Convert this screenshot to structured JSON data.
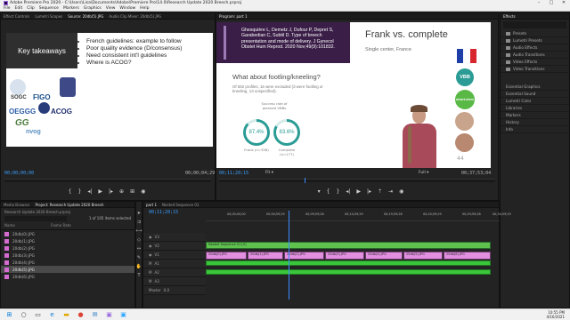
{
  "window": {
    "title": "Adobe Premiere Pro 2020 - C:\\Users\\Lisa\\Documents\\Adobe\\Premiere Pro\\14.0\\Research Update 2020 Breech.prproj",
    "controls": [
      "–",
      "□",
      "✕"
    ]
  },
  "menu": [
    "File",
    "Edit",
    "Clip",
    "Sequence",
    "Markers",
    "Graphics",
    "View",
    "Window",
    "Help"
  ],
  "source_panel": {
    "tabs": [
      "Effect Controls",
      "Lumetri Scopes",
      "Source: 20db(5).JPG",
      "Audio Clip Mixer: 20db(5).JPG"
    ],
    "timecode_in": "00;00;00;00",
    "timecode_out": "00;00;04;29",
    "slide": {
      "heading": "Key takeaways",
      "bullets": [
        "French guidelines: example to follow",
        "Poor quality evidence (D/consensus)",
        "Need consistent int'l guidelines",
        "Where is ACOG?"
      ],
      "logos": [
        "SOGC",
        "FIGO",
        "OEGGG",
        "ACOG",
        "GG",
        "nvog"
      ]
    }
  },
  "program_panel": {
    "tab": "Program: part 1",
    "timecode": "00;11;20;15",
    "fit": "Fit",
    "quality": "Full",
    "duration": "00;37;53;04",
    "slide": {
      "citation": "Ghesquière L, Demetz J, Dufour P, Depret S, Garabedian C, Subtil D. Type of breech presentation and mode of delivery. J Gynecol Obstet Hum Reprod. 2020 Nov;49(9):101832.",
      "title": "Frank vs. complete",
      "subtitle": "Single center, France",
      "question": "What about footling/kneeling?",
      "question_sub": "Of 592 profiles, 16 were excluded (3 were footling or kneeling, 13 unspecified).",
      "donut_caption": "Success rate of planned VBBs",
      "donuts": [
        {
          "value": "87.4%",
          "label": "Frank (n=358)",
          "fraction": 0.874
        },
        {
          "value": "83.6%",
          "label": "Complete (n=177)",
          "fraction": 0.836
        }
      ],
      "badges": [
        "VBB",
        "short-term"
      ],
      "page_number": "44"
    }
  },
  "effects_panel": {
    "title": "Effects",
    "items": [
      "Presets",
      "Lumetri Presets",
      "Audio Effects",
      "Audio Transitions",
      "Video Effects",
      "Video Transitions"
    ],
    "sections": [
      "Essential Graphics",
      "Essential Sound",
      "Lumetri Color",
      "Libraries",
      "Markers",
      "History",
      "Info"
    ]
  },
  "project_panel": {
    "tabs": [
      "Media Browser",
      "Project: Research Update 2020 Breech"
    ],
    "project_file": "Research Update 2020 Breech.prproj",
    "selection": "1 of 105 items selected",
    "columns": [
      "Name",
      "Frame Rate"
    ],
    "items": [
      "20db(0).JPG",
      "20db(1).JPG",
      "20db(2).JPG",
      "20db(3).JPG",
      "20db(4).JPG",
      "20db(5).JPG",
      "20db(6).JPG"
    ],
    "selected_index": 5
  },
  "timeline": {
    "tabs": [
      "part 1",
      "Nested Sequence 01"
    ],
    "timecode": "00;11;20;15",
    "ruler": [
      "00;00;00;00",
      "00;04;59;29",
      "00;09;59;28",
      "00;14;59;29",
      "00;19;59;28",
      "00;24;59;29",
      "00;29;59;28",
      "00;34;59;29"
    ],
    "tracks": [
      "V3",
      "V2",
      "V1",
      "A1",
      "A2",
      "A3"
    ],
    "master": "Master",
    "master_value": "0.0",
    "v3_clip": "Nested Sequence 01 [V]",
    "v1_clips": [
      "20db(0).JPG",
      "20db(1).JPG",
      "20db(2).JPG",
      "20db(3).JPG",
      "20db(4).JPG",
      "20db(5).JPG",
      "20db(6).JPG"
    ]
  },
  "taskbar": {
    "time": "10:55 PM",
    "date": "4/16/2021"
  },
  "colors": {
    "accent": "#3b9fff",
    "citation_bg": "#3a1e47",
    "teal": "#2b9c95",
    "video_clip": "#e28fe0",
    "audio_clip": "#4fb84c"
  }
}
